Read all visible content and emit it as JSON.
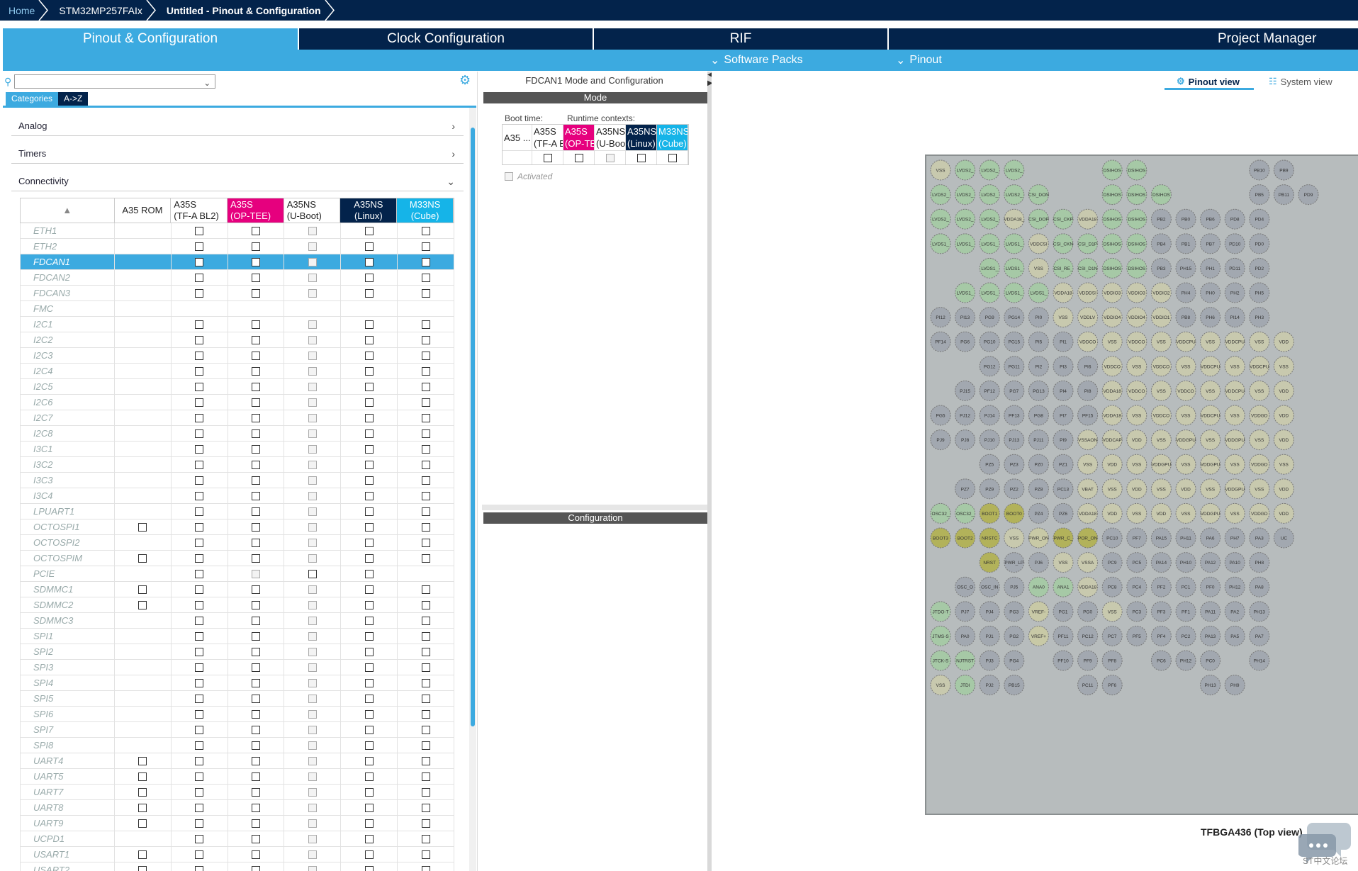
{
  "breadcrumbs": [
    {
      "label": "Home",
      "kind": "home"
    },
    {
      "label": "STM32MP257FAIx",
      "kind": "normal"
    },
    {
      "label": "Untitled - Pinout & Configuration",
      "kind": "active"
    }
  ],
  "main_tabs": [
    {
      "label": "Pinout & Configuration",
      "active": true
    },
    {
      "label": "Clock Configuration",
      "active": false
    },
    {
      "label": "RIF",
      "active": false
    },
    {
      "label": "Project Manager",
      "active": false
    }
  ],
  "sub_menu": {
    "software_packs": "Software Packs",
    "pinout": "Pinout"
  },
  "left": {
    "search_value": "",
    "tab_categories": "Categories",
    "tab_az": "A->Z",
    "categories": [
      {
        "label": "Analog",
        "expanded": false
      },
      {
        "label": "Timers",
        "expanded": false
      },
      {
        "label": "Connectivity",
        "expanded": true
      }
    ],
    "columns": [
      "A35 ROM",
      "A35S (TF-A  BL2)",
      "A35S (OP-TEE)",
      "A35NS (U-Boot)",
      "A35NS (Linux)",
      "M33NS (Cube)"
    ],
    "col_lines": [
      [
        "A35 ROM"
      ],
      [
        "A35S",
        "(TF-A  BL2)"
      ],
      [
        "A35S",
        "(OP-TEE)"
      ],
      [
        "A35NS",
        "(U-Boot)"
      ],
      [
        "A35NS",
        "(Linux)"
      ],
      [
        "M33NS",
        "(Cube)"
      ]
    ],
    "selected_row": "FDCAN1",
    "rows": [
      {
        "name": "ETH1",
        "cells": [
          0,
          1,
          1,
          2,
          1,
          1
        ]
      },
      {
        "name": "ETH2",
        "cells": [
          0,
          1,
          1,
          2,
          1,
          1
        ]
      },
      {
        "name": "FDCAN1",
        "cells": [
          0,
          1,
          1,
          2,
          1,
          1
        ]
      },
      {
        "name": "FDCAN2",
        "cells": [
          0,
          1,
          1,
          2,
          1,
          1
        ]
      },
      {
        "name": "FDCAN3",
        "cells": [
          0,
          1,
          1,
          2,
          1,
          1
        ]
      },
      {
        "name": "FMC",
        "cells": [
          0,
          0,
          0,
          0,
          0,
          0
        ]
      },
      {
        "name": "I2C1",
        "cells": [
          0,
          1,
          1,
          2,
          1,
          1
        ]
      },
      {
        "name": "I2C2",
        "cells": [
          0,
          1,
          1,
          2,
          1,
          1
        ]
      },
      {
        "name": "I2C3",
        "cells": [
          0,
          1,
          1,
          2,
          1,
          1
        ]
      },
      {
        "name": "I2C4",
        "cells": [
          0,
          1,
          1,
          2,
          1,
          1
        ]
      },
      {
        "name": "I2C5",
        "cells": [
          0,
          1,
          1,
          2,
          1,
          1
        ]
      },
      {
        "name": "I2C6",
        "cells": [
          0,
          1,
          1,
          2,
          1,
          1
        ]
      },
      {
        "name": "I2C7",
        "cells": [
          0,
          1,
          1,
          2,
          1,
          1
        ]
      },
      {
        "name": "I2C8",
        "cells": [
          0,
          1,
          1,
          2,
          1,
          1
        ]
      },
      {
        "name": "I3C1",
        "cells": [
          0,
          1,
          1,
          2,
          1,
          1
        ]
      },
      {
        "name": "I3C2",
        "cells": [
          0,
          1,
          1,
          2,
          1,
          1
        ]
      },
      {
        "name": "I3C3",
        "cells": [
          0,
          1,
          1,
          2,
          1,
          1
        ]
      },
      {
        "name": "I3C4",
        "cells": [
          0,
          1,
          1,
          2,
          1,
          1
        ]
      },
      {
        "name": "LPUART1",
        "cells": [
          0,
          1,
          1,
          2,
          1,
          1
        ]
      },
      {
        "name": "OCTOSPI1",
        "cells": [
          1,
          1,
          1,
          2,
          1,
          1
        ]
      },
      {
        "name": "OCTOSPI2",
        "cells": [
          0,
          1,
          1,
          2,
          1,
          1
        ]
      },
      {
        "name": "OCTOSPIM",
        "cells": [
          1,
          1,
          1,
          2,
          1,
          1
        ]
      },
      {
        "name": "PCIE",
        "cells": [
          0,
          1,
          2,
          1,
          1,
          0
        ]
      },
      {
        "name": "SDMMC1",
        "cells": [
          1,
          1,
          1,
          2,
          1,
          1
        ]
      },
      {
        "name": "SDMMC2",
        "cells": [
          1,
          1,
          1,
          2,
          1,
          1
        ]
      },
      {
        "name": "SDMMC3",
        "cells": [
          0,
          1,
          1,
          2,
          1,
          1
        ]
      },
      {
        "name": "SPI1",
        "cells": [
          0,
          1,
          1,
          2,
          1,
          1
        ]
      },
      {
        "name": "SPI2",
        "cells": [
          0,
          1,
          1,
          2,
          1,
          1
        ]
      },
      {
        "name": "SPI3",
        "cells": [
          0,
          1,
          1,
          2,
          1,
          1
        ]
      },
      {
        "name": "SPI4",
        "cells": [
          0,
          1,
          1,
          2,
          1,
          1
        ]
      },
      {
        "name": "SPI5",
        "cells": [
          0,
          1,
          1,
          2,
          1,
          1
        ]
      },
      {
        "name": "SPI6",
        "cells": [
          0,
          1,
          1,
          2,
          1,
          1
        ]
      },
      {
        "name": "SPI7",
        "cells": [
          0,
          1,
          1,
          2,
          1,
          1
        ]
      },
      {
        "name": "SPI8",
        "cells": [
          0,
          1,
          1,
          2,
          1,
          1
        ]
      },
      {
        "name": "UART4",
        "cells": [
          1,
          1,
          1,
          2,
          1,
          1
        ]
      },
      {
        "name": "UART5",
        "cells": [
          1,
          1,
          1,
          2,
          1,
          1
        ]
      },
      {
        "name": "UART7",
        "cells": [
          1,
          1,
          1,
          2,
          1,
          1
        ]
      },
      {
        "name": "UART8",
        "cells": [
          1,
          1,
          1,
          2,
          1,
          1
        ]
      },
      {
        "name": "UART9",
        "cells": [
          1,
          1,
          1,
          2,
          1,
          1
        ]
      },
      {
        "name": "UCPD1",
        "cells": [
          0,
          1,
          1,
          2,
          1,
          1
        ]
      },
      {
        "name": "USART1",
        "cells": [
          1,
          1,
          1,
          2,
          1,
          1
        ]
      },
      {
        "name": "USART2",
        "cells": [
          1,
          1,
          1,
          2,
          1,
          1
        ]
      }
    ]
  },
  "middle": {
    "title": "FDCAN1 Mode and Configuration",
    "mode_bar": "Mode",
    "config_bar": "Configuration",
    "boot_time": "Boot time:",
    "runtime_contexts": "Runtime contexts:",
    "ctx_first": "A35 ...",
    "ctx_cols": [
      [
        "A35S",
        "(TF-A  BL2)"
      ],
      [
        "A35S",
        "(OP-TEE)"
      ],
      [
        "A35NS",
        "(U-Boot)"
      ],
      [
        "A35NS",
        "(Linux)"
      ],
      [
        "M33NS",
        "(Cube)"
      ]
    ],
    "activated": "Activated"
  },
  "right": {
    "pinout_view": "Pinout view",
    "system_view": "System view",
    "package_label": "TFBGA436 (Top view)",
    "watermark": "ST中文论坛",
    "pins": [
      [
        "VSS",
        "LVDS2_",
        "LVDS2_",
        "LVDS2_",
        "",
        "",
        "",
        "DSIHOS",
        "DSIHOS",
        "",
        "",
        "",
        "",
        "PB10",
        "PB9",
        "",
        ""
      ],
      [
        "LVDS2_",
        "LVDS2_",
        "LVDS2_",
        "LVDS2_",
        "CSI_DON",
        "",
        "",
        "DSIHOS",
        "DSIHOS",
        "DSIHOS",
        "",
        "",
        "",
        "PB5",
        "PB11",
        "PD9",
        ""
      ],
      [
        "LVDS2_",
        "LVDS2_",
        "LVDS2_",
        "VDDA18_",
        "CSI_DOP",
        "CSI_CKP",
        "VDDA18",
        "DSIHOS",
        "DSIHOS",
        "PB2",
        "PB0",
        "PB6",
        "PD8",
        "PD4",
        ""
      ],
      [
        "LVDS1_",
        "LVDS1_",
        "LVDS1_",
        "LVDS1_",
        "VDDCSI",
        "CSI_CKN",
        "CSI_D1P",
        "DSIHOS",
        "DSIHOS",
        "PB4",
        "PB1",
        "PB7",
        "PD10",
        "PD0",
        ""
      ],
      [
        "",
        "",
        "LVDS1_",
        "LVDS1_",
        "VSS",
        "CSI_RE_",
        "CSI_D1N",
        "DSIHOS",
        "DSIHOS",
        "PB3",
        "PH15",
        "PH1",
        "PD11",
        "PD2",
        ""
      ],
      [
        "",
        "LVDS1_",
        "LVDS1_",
        "LVDS1_",
        "LVDS1_",
        "VDDA18",
        "VDDDSI",
        "VDDIO3",
        "VDDIO3",
        "VDDIO2",
        "PH4",
        "PH0",
        "PH2",
        "PH5",
        ""
      ],
      [
        "PI12",
        "PI13",
        "PG9",
        "PG14",
        "PI0",
        "VSS",
        "VDDLV",
        "VDDIO4",
        "VDDIO4",
        "VDDIO1",
        "PB8",
        "PH6",
        "PI14",
        "PH3",
        ""
      ],
      [
        "PF14",
        "PG6",
        "PG10",
        "PG15",
        "PI5",
        "PI1",
        "VDDCO",
        "VSS",
        "VDDCO",
        "VSS",
        "VDDCPU",
        "VSS",
        "VDDCPU",
        "VSS",
        "VDD"
      ],
      [
        "",
        "",
        "PG12",
        "PG11",
        "PI2",
        "PI3",
        "PI6",
        "VDDCO",
        "VSS",
        "VDDCO",
        "VSS",
        "VDDCPU",
        "VSS",
        "VDDCPU",
        "VSS"
      ],
      [
        "",
        "PJ15",
        "PF12",
        "PG7",
        "PG13",
        "PI4",
        "PI8",
        "VDDA18",
        "VDDCO",
        "VSS",
        "VDDCO",
        "VSS",
        "VDDCPU",
        "VSS",
        "VDD"
      ],
      [
        "PG5",
        "PJ12",
        "PJ14",
        "PF13",
        "PG8",
        "PI7",
        "PF15",
        "VDDA18",
        "VSS",
        "VDDCO",
        "VSS",
        "VDDCPU",
        "VSS",
        "VDDGD",
        "VDD"
      ],
      [
        "PJ9",
        "PJ8",
        "PJ10",
        "PJ13",
        "PJ11",
        "PI9",
        "VSSAON",
        "VDDCAP",
        "VDD",
        "VSS",
        "VDDGPU",
        "VSS",
        "VDDGPU",
        "VSS",
        "VDD"
      ],
      [
        "",
        "",
        "PZ5",
        "PZ3",
        "PZ0",
        "PZ1",
        "VSS",
        "VDD",
        "VSS",
        "VDDGPU",
        "VSS",
        "VDDGPU",
        "VSS",
        "VDDGD",
        "VSS"
      ],
      [
        "",
        "PZ7",
        "PZ9",
        "PZ2",
        "PZ8",
        "PC13",
        "VBAT",
        "VSS",
        "VDD",
        "VSS",
        "VDD",
        "VSS",
        "VDDGPU",
        "VSS",
        "VDD"
      ],
      [
        "OSC32_",
        "OSC32_",
        "BOOT1",
        "BOOT0",
        "PZ4",
        "PZ6",
        "VDDA18",
        "VDD",
        "VSS",
        "VDD",
        "VSS",
        "VDDGPU",
        "VSS",
        "VDDGD",
        "VDD"
      ],
      [
        "BOOT3",
        "BOOT2",
        "NRSTC",
        "VSS",
        "PWR_ON",
        "PWR_C_",
        "POR_ON",
        "PC10",
        "PF7",
        "PA15",
        "PH11",
        "PA6",
        "PH7",
        "PA3",
        "UC"
      ],
      [
        "",
        "",
        "NRST",
        "PWR_LP",
        "PJ6",
        "VSS",
        "VSSA",
        "PC9",
        "PC5",
        "PA14",
        "PH10",
        "PA12",
        "PA10",
        "PH8",
        ""
      ],
      [
        "",
        "OSC_O",
        "OSC_IN",
        "PJ5",
        "ANA0",
        "ANA1",
        "VDDA18",
        "PC8",
        "PC4",
        "PF2",
        "PC1",
        "PF0",
        "PH12",
        "PA8",
        ""
      ],
      [
        "JTDO-T",
        "PJ7",
        "PJ4",
        "PG3",
        "VREF-",
        "PG1",
        "PG0",
        "VSS",
        "PC3",
        "PF3",
        "PF1",
        "PA11",
        "PA2",
        "PH13",
        ""
      ],
      [
        "JTMS-S",
        "PA0",
        "PJ1",
        "PG2",
        "VREF+",
        "PF11",
        "PC12",
        "PC7",
        "PF5",
        "PF4",
        "PC2",
        "PA13",
        "PA5",
        "PA7",
        ""
      ],
      [
        "JTCK-S",
        "NJTRST",
        "PJ3",
        "PG4",
        "",
        "PF10",
        "PF9",
        "PF8",
        "",
        "PC6",
        "PH12",
        "PC0",
        "",
        "PH14",
        ""
      ],
      [
        "VSS",
        "JTDI",
        "PJ2",
        "PB15",
        "",
        "",
        "PC11",
        "PF6",
        "",
        "",
        "",
        "PH13",
        "PH9",
        "",
        ""
      ]
    ]
  }
}
